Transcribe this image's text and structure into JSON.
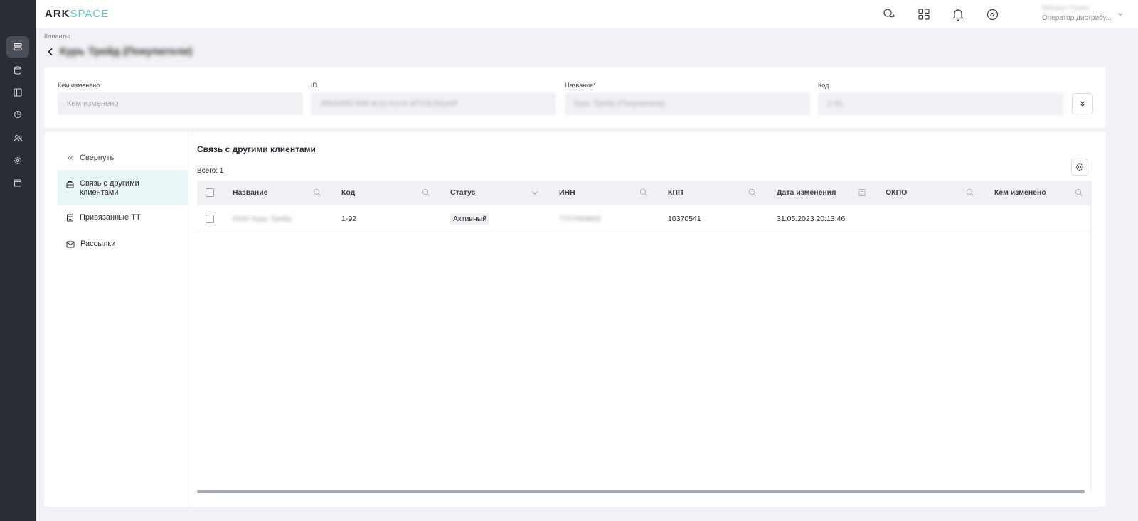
{
  "app": {
    "logo_part1": "ARK",
    "logo_part2": "SPACE",
    "user_name": "Михаил Ошин",
    "user_role": "Оператор дистрибу..."
  },
  "rail": {
    "items": [
      {
        "icon": "list-icon",
        "active": true
      },
      {
        "icon": "database-icon",
        "active": false
      },
      {
        "icon": "layout-icon",
        "active": false
      },
      {
        "icon": "pie-chart-icon",
        "active": false
      },
      {
        "icon": "users-icon",
        "active": false
      },
      {
        "icon": "gear-icon",
        "active": false
      },
      {
        "icon": "calendar-icon",
        "active": false
      }
    ]
  },
  "topbar": {
    "icons": [
      "chat-icon",
      "apps-grid-icon",
      "bell-icon",
      "sync-icon"
    ]
  },
  "breadcrumb": "Клиенты",
  "page_title": "Курь Трейд (Покупатели)",
  "fields": [
    {
      "label": "Кем изменено",
      "value": "Кем изменено",
      "placeholder": true
    },
    {
      "label": "ID",
      "value": "36b4d9f0-6f4f-4c1c-b1c9-af7e3c2b1e0f",
      "placeholder": false
    },
    {
      "label": "Название*",
      "value": "Курь Трейд (Покупатели)",
      "placeholder": false
    },
    {
      "label": "Код",
      "value": "1-91",
      "placeholder": false
    }
  ],
  "side_menu": {
    "collapse": "Свернуть",
    "items": [
      {
        "label": "Связь с другими клиентами",
        "icon": "briefcase-icon",
        "active": true
      },
      {
        "label": "Привязанные ТТ",
        "icon": "store-icon",
        "active": false
      },
      {
        "label": "Рассылки",
        "icon": "mail-icon",
        "active": false
      }
    ]
  },
  "section": {
    "title": "Связь с другими клиентами",
    "total": "Всего: 1"
  },
  "table": {
    "columns": [
      "Название",
      "Код",
      "Статус",
      "ИНН",
      "КПП",
      "Дата изменения",
      "ОКПО",
      "Кем изменено"
    ],
    "rows": [
      {
        "name": "ООО Курь Трейд",
        "code": "1-92",
        "status": "Активный",
        "inn": "7707083893",
        "kpp": "10370541",
        "date": "31.05.2023 20:13:46",
        "okpo": "",
        "changed_by": ""
      }
    ]
  }
}
